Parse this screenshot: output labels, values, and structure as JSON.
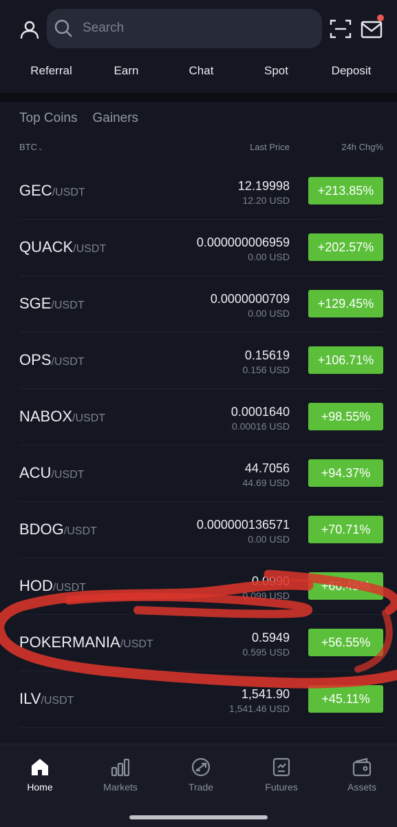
{
  "search": {
    "placeholder": "Search"
  },
  "shortcuts": [
    "Referral",
    "Earn",
    "Chat",
    "Spot",
    "Deposit"
  ],
  "tabs": [
    "Top Coins",
    "Gainers"
  ],
  "table_header": {
    "quote_filter": "BTC",
    "last_price": "Last Price",
    "change_24h": "24h Chg%"
  },
  "rows": [
    {
      "base": "GEC",
      "quote": "/USDT",
      "price": "12.19998",
      "usd": "12.20 USD",
      "change": "+213.85%"
    },
    {
      "base": "QUACK",
      "quote": "/USDT",
      "price": "0.000000006959",
      "usd": "0.00 USD",
      "change": "+202.57%"
    },
    {
      "base": "SGE",
      "quote": "/USDT",
      "price": "0.0000000709",
      "usd": "0.00 USD",
      "change": "+129.45%"
    },
    {
      "base": "OPS",
      "quote": "/USDT",
      "price": "0.15619",
      "usd": "0.156 USD",
      "change": "+106.71%"
    },
    {
      "base": "NABOX",
      "quote": "/USDT",
      "price": "0.0001640",
      "usd": "0.00016 USD",
      "change": "+98.55%"
    },
    {
      "base": "ACU",
      "quote": "/USDT",
      "price": "44.7056",
      "usd": "44.69 USD",
      "change": "+94.37%"
    },
    {
      "base": "BDOG",
      "quote": "/USDT",
      "price": "0.000000136571",
      "usd": "0.00 USD",
      "change": "+70.71%"
    },
    {
      "base": "HOD",
      "quote": "/USDT",
      "price": "0.0990",
      "usd": "0.099 USD",
      "change": "+60.45%"
    },
    {
      "base": "POKERMANIA",
      "quote": "/USDT",
      "price": "0.5949",
      "usd": "0.595 USD",
      "change": "+56.55%"
    },
    {
      "base": "ILV",
      "quote": "/USDT",
      "price": "1,541.90",
      "usd": "1,541.46 USD",
      "change": "+45.11%"
    }
  ],
  "bottom_nav": [
    {
      "label": "Home",
      "icon": "home-icon",
      "active": true
    },
    {
      "label": "Markets",
      "icon": "markets-icon",
      "active": false
    },
    {
      "label": "Trade",
      "icon": "trade-icon",
      "active": false
    },
    {
      "label": "Futures",
      "icon": "futures-icon",
      "active": false
    },
    {
      "label": "Assets",
      "icon": "assets-icon",
      "active": false
    }
  ],
  "colors": {
    "background": "#141721",
    "gain": "#5bbf3a",
    "scribble": "#d9352a",
    "notification_dot": "#e5594f"
  }
}
